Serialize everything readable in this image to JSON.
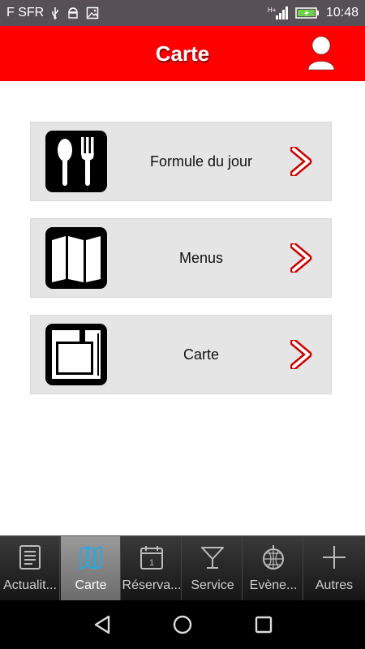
{
  "status_bar": {
    "carrier": "F SFR",
    "time": "10:48",
    "signal_text": "H+"
  },
  "header": {
    "title": "Carte"
  },
  "cards": [
    {
      "label": "Formule du jour",
      "icon": "fork-knife-icon"
    },
    {
      "label": "Menus",
      "icon": "map-icon"
    },
    {
      "label": "Carte",
      "icon": "book-icon"
    }
  ],
  "tabs": [
    {
      "label": "Actualit...",
      "icon": "news-icon",
      "active": false
    },
    {
      "label": "Carte",
      "icon": "map-icon",
      "active": true
    },
    {
      "label": "Réserva...",
      "icon": "calendar-icon",
      "active": false
    },
    {
      "label": "Service",
      "icon": "cocktail-icon",
      "active": false
    },
    {
      "label": "Evène...",
      "icon": "disco-ball-icon",
      "active": false
    },
    {
      "label": "Autres",
      "icon": "plus-icon",
      "active": false
    }
  ],
  "colors": {
    "accent": "#ff0000",
    "chevron": "#cc0000",
    "card_bg": "#e5e5e5",
    "status_bar": "#575057",
    "active_tab_icon": "#2aa8e0"
  }
}
